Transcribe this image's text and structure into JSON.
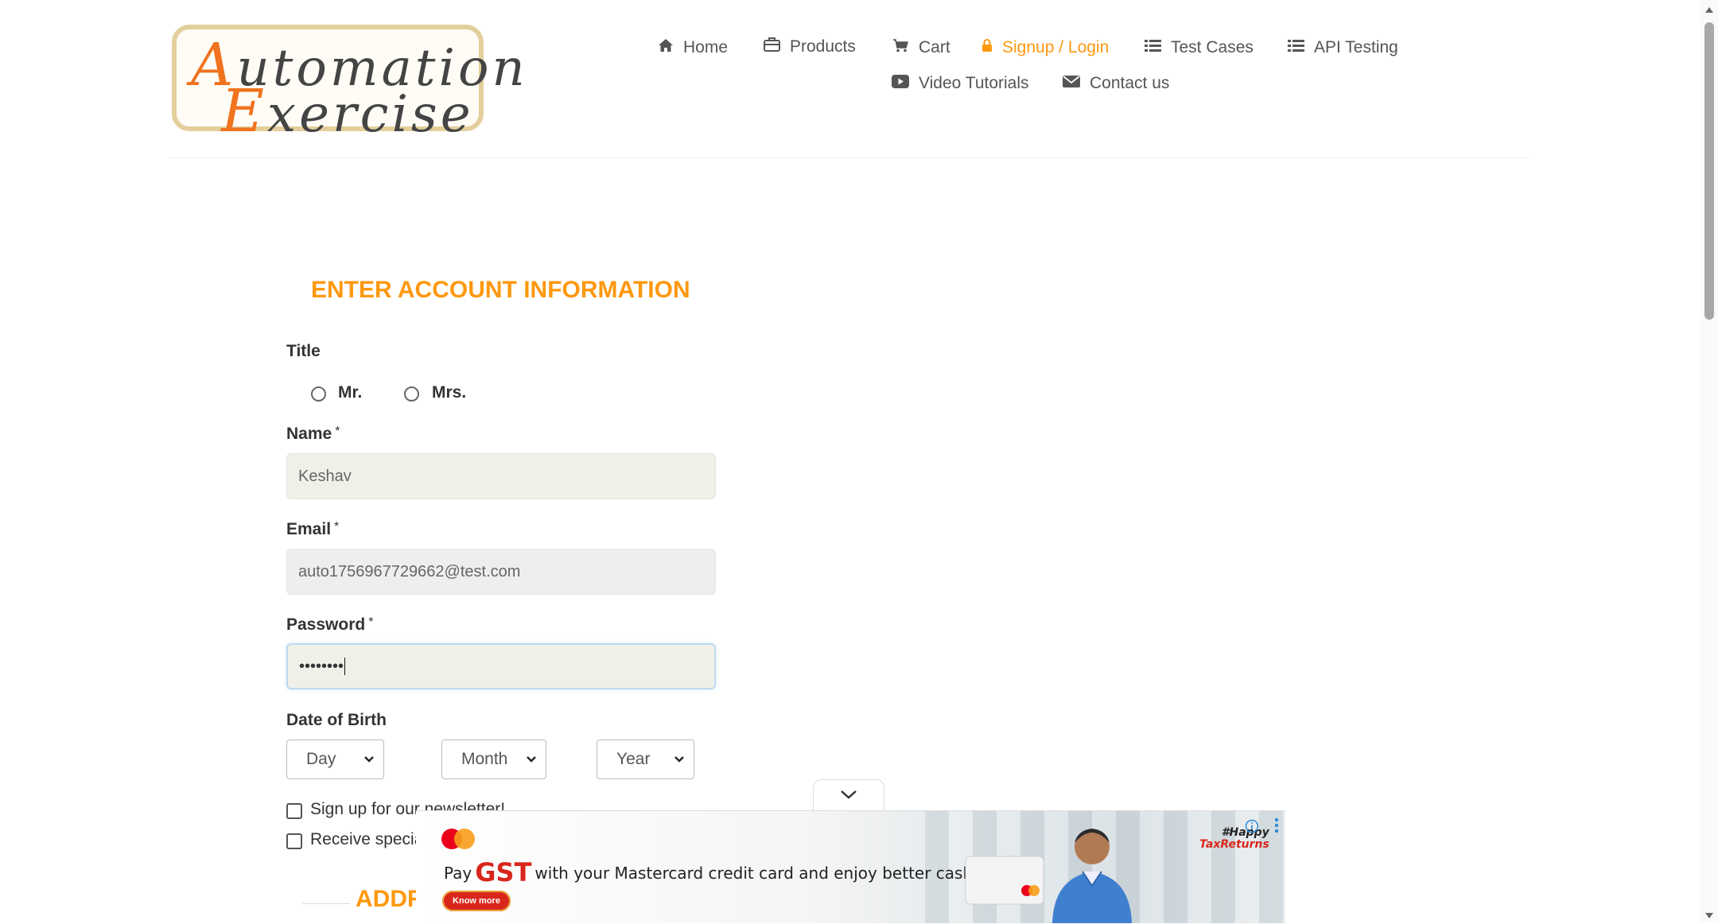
{
  "logo": {
    "line1_cap": "A",
    "line1_rest": "utomation",
    "line2_cap": "E",
    "line2_rest": "xercise"
  },
  "nav": {
    "items": [
      {
        "label": "Home",
        "icon": "home-icon"
      },
      {
        "label": "Products",
        "icon": "briefcase-icon"
      },
      {
        "label": "Cart",
        "icon": "cart-icon"
      },
      {
        "label": "Signup / Login",
        "icon": "lock-icon",
        "active": true
      },
      {
        "label": "Test Cases",
        "icon": "list-icon"
      },
      {
        "label": "API Testing",
        "icon": "list-icon"
      },
      {
        "label": "Video Tutorials",
        "icon": "youtube-play-icon"
      },
      {
        "label": "Contact us",
        "icon": "envelope-icon"
      }
    ]
  },
  "form": {
    "section_title": "ENTER ACCOUNT INFORMATION",
    "title_label": "Title",
    "title_options": [
      "Mr.",
      "Mrs."
    ],
    "name_label": "Name",
    "name_value": "Keshav",
    "email_label": "Email",
    "email_value": "auto1756967729662@test.com",
    "password_label": "Password",
    "password_value": "••••••••",
    "required_mark": "*",
    "dob_label": "Date of Birth",
    "dob_day": "Day",
    "dob_month": "Month",
    "dob_year": "Year",
    "newsletter_label": "Sign up for our newsletter!",
    "offers_label": "Receive special offers from our partners!",
    "address_title": "ADDRESS INFORMATION"
  },
  "ad": {
    "text_before": "Pay",
    "highlight": "GST",
    "text_after": "with your Mastercard credit card and enjoy better cash flows",
    "button": "Know more",
    "tag_line1": "#Happy",
    "tag_line2": "TaxReturns"
  },
  "colors": {
    "accent": "#fe980f",
    "text": "#333333",
    "ad_red": "#d9261c"
  }
}
